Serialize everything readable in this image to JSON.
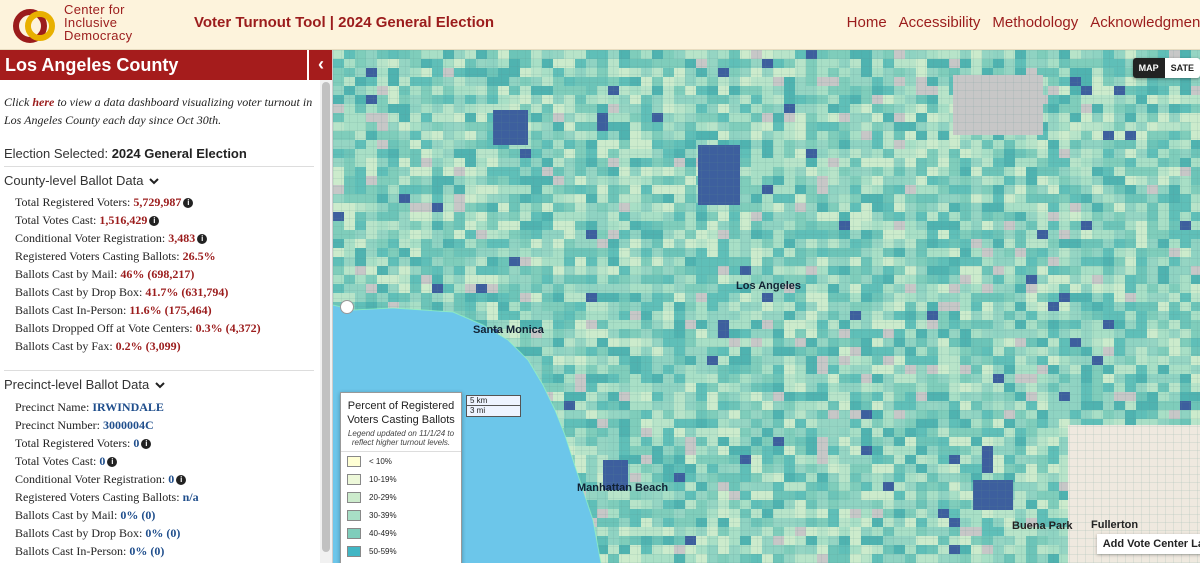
{
  "header": {
    "logo_lines": [
      "Center for",
      "Inclusive",
      "Democracy"
    ],
    "app_title": "Voter Turnout Tool | 2024 General Election",
    "nav": [
      "Home",
      "Accessibility",
      "Methodology",
      "Acknowledgments"
    ]
  },
  "sidebar": {
    "county_title": "Los Angeles County",
    "collapse_glyph": "‹",
    "intro_prefix": "Click ",
    "intro_link": "here",
    "intro_suffix": " to view a data dashboard visualizing voter turnout in Los Angeles County each day since Oct 30th.",
    "election_label": "Election Selected: ",
    "election_value": "2024 General Election",
    "county_section": {
      "heading": "County-level Ballot Data",
      "rows": [
        {
          "label": "Total Registered Voters: ",
          "value": "5,729,987",
          "info": true
        },
        {
          "label": "Total Votes Cast: ",
          "value": "1,516,429",
          "info": true
        },
        {
          "label": "Conditional Voter Registration: ",
          "value": "3,483",
          "info": true
        },
        {
          "label": "Registered Voters Casting Ballots: ",
          "value": "26.5%",
          "info": false
        },
        {
          "label": "Ballots Cast by Mail: ",
          "value": "46% (698,217)",
          "info": false
        },
        {
          "label": "Ballots Cast by Drop Box: ",
          "value": "41.7% (631,794)",
          "info": false
        },
        {
          "label": "Ballots Cast In-Person: ",
          "value": "11.6% (175,464)",
          "info": false
        },
        {
          "label": "Ballots Dropped Off at Vote Centers: ",
          "value": "0.3% (4,372)",
          "info": false
        },
        {
          "label": "Ballots Cast by Fax: ",
          "value": "0.2% (3,099)",
          "info": false
        }
      ]
    },
    "precinct_section": {
      "heading": "Precinct-level Ballot Data",
      "rows": [
        {
          "label": "Precinct Name: ",
          "value": "IRWINDALE",
          "info": false
        },
        {
          "label": "Precinct Number: ",
          "value": "3000004C",
          "info": false
        },
        {
          "label": "Total Registered Voters: ",
          "value": "0",
          "info": true
        },
        {
          "label": "Total Votes Cast: ",
          "value": "0",
          "info": true
        },
        {
          "label": "Conditional Voter Registration: ",
          "value": "0",
          "info": true
        },
        {
          "label": "Registered Voters Casting Ballots: ",
          "value": "n/a",
          "info": false
        },
        {
          "label": "Ballots Cast by Mail: ",
          "value": "0% (0)",
          "info": false
        },
        {
          "label": "Ballots Cast by Drop Box: ",
          "value": "0% (0)",
          "info": false
        },
        {
          "label": "Ballots Cast In-Person: ",
          "value": "0% (0)",
          "info": false
        }
      ]
    }
  },
  "map": {
    "toggle": [
      "MAP",
      "SATE"
    ],
    "scale": [
      "5 km",
      "3 mi"
    ],
    "legend": {
      "title": "Percent of Registered Voters Casting Ballots",
      "note": "Legend updated on 11/1/24 to reflect higher turnout levels.",
      "items": [
        {
          "label": "< 10%",
          "color": "#ffffd4"
        },
        {
          "label": "10-19%",
          "color": "#edf8d9"
        },
        {
          "label": "20-29%",
          "color": "#ccebcc"
        },
        {
          "label": "30-39%",
          "color": "#a8dfc6"
        },
        {
          "label": "40-49%",
          "color": "#7fcdbb"
        },
        {
          "label": "50-59%",
          "color": "#41b6c4"
        }
      ]
    },
    "add_vote_center": "Add Vote Center La",
    "places": [
      {
        "name": "Santa Monica"
      },
      {
        "name": "Los Angeles"
      },
      {
        "name": "Manhattan Beach"
      },
      {
        "name": "Buena Park"
      },
      {
        "name": "Fullerton"
      }
    ],
    "colors": {
      "ocean": "#6cc6ea",
      "land_base": "#7fc9c7",
      "high_turnout": "#3d5f9e",
      "no_data": "#c7c7c7"
    }
  }
}
